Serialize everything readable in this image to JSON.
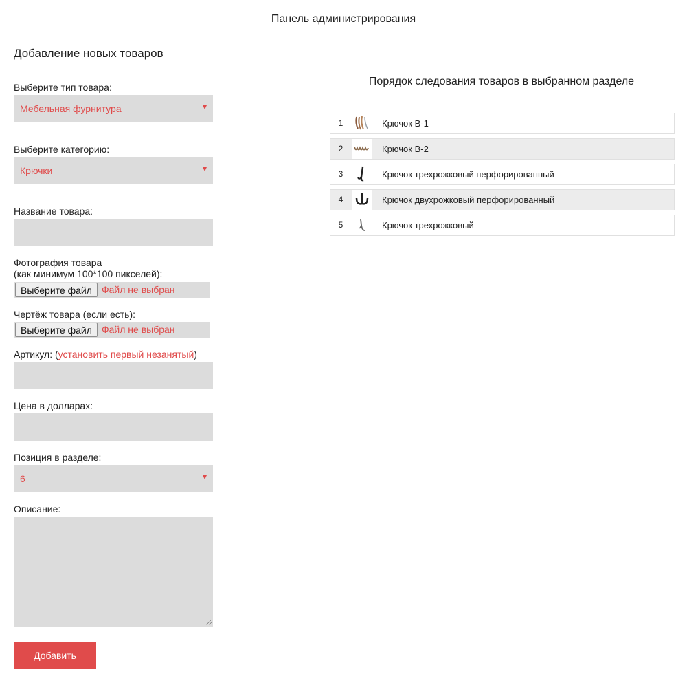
{
  "page_title": "Панель администрирования",
  "form": {
    "section_title": "Добавление новых товаров",
    "type_label": "Выберите тип товара:",
    "type_value": "Мебельная фурнитура",
    "category_label": "Выберите категорию:",
    "category_value": "Крючки",
    "name_label": "Название товара:",
    "name_value": "",
    "photo_label_line1": "Фотография товара",
    "photo_label_line2": "(как минимум 100*100 пикселей):",
    "photo_button": "Выберите файл",
    "photo_status": "Файл не выбран",
    "drawing_label": "Чертёж товара (если есть):",
    "drawing_button": "Выберите файл",
    "drawing_status": "Файл не выбран",
    "article_label": "Артикул: (",
    "article_link": "установить первый незанятый",
    "article_label_end": ")",
    "article_value": "",
    "price_label": "Цена в долларах:",
    "price_value": "",
    "position_label": "Позиция в разделе:",
    "position_value": "6",
    "description_label": "Описание:",
    "description_value": "",
    "submit_label": "Добавить"
  },
  "order": {
    "title": "Порядок следования товаров в выбранном разделе",
    "items": [
      {
        "num": "1",
        "name": "Крючок В-1",
        "icon": "hook-v1-icon"
      },
      {
        "num": "2",
        "name": "Крючок В-2",
        "icon": "hook-v2-icon"
      },
      {
        "num": "3",
        "name": "Крючок трехрожковый перфорированный",
        "icon": "triple-hook-perforated-icon"
      },
      {
        "num": "4",
        "name": "Крючок двухрожковый перфорированный",
        "icon": "double-hook-perforated-icon"
      },
      {
        "num": "5",
        "name": "Крючок трехрожковый",
        "icon": "triple-hook-icon"
      }
    ]
  },
  "colors": {
    "accent": "#e04b4b",
    "field_bg": "#dcdcdc",
    "alt_row_bg": "#ececec"
  }
}
